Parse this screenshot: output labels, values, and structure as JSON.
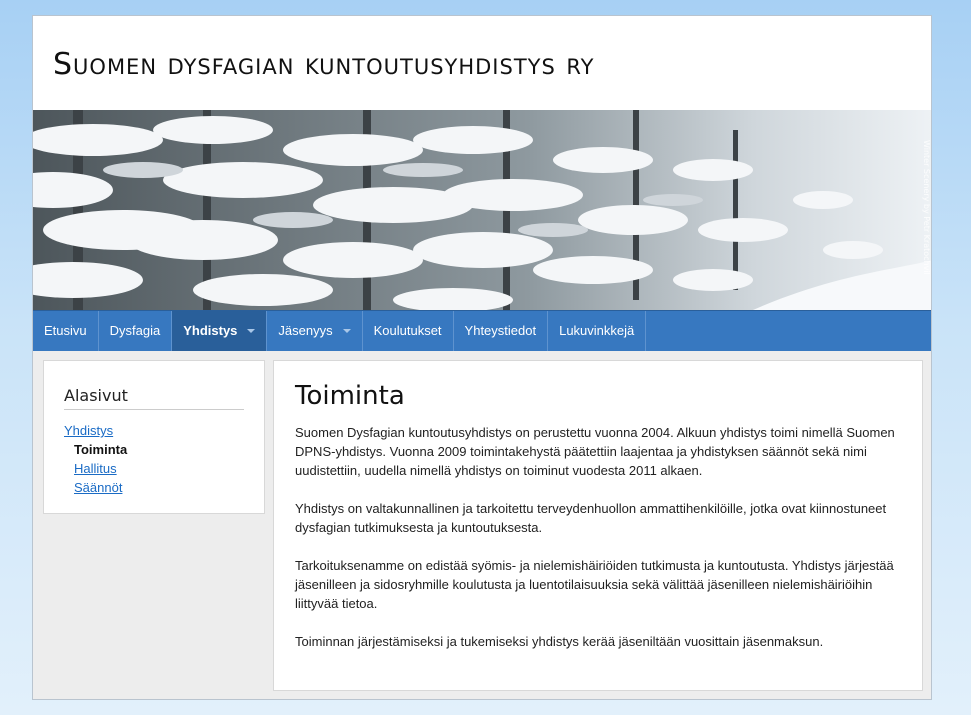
{
  "header": {
    "site_title": "Suomen dysfagian kuntoutusyhdistys ry"
  },
  "banner": {
    "credit": "Winter Scenery by Petr Kratochvil"
  },
  "nav": {
    "items": [
      {
        "label": "Etusivu"
      },
      {
        "label": "Dysfagia"
      },
      {
        "label": "Yhdistys",
        "active": true
      },
      {
        "label": "Jäsenyys"
      },
      {
        "label": "Koulutukset"
      },
      {
        "label": "Yhteystiedot"
      },
      {
        "label": "Lukuvinkkejä"
      }
    ]
  },
  "sidebar": {
    "title": "Alasivut",
    "parent_link": "Yhdistys",
    "current": "Toiminta",
    "links": [
      "Hallitus",
      "Säännöt"
    ]
  },
  "content": {
    "title": "Toiminta",
    "paragraphs": [
      "Suomen Dysfagian kuntoutusyhdistys on perustettu vuonna 2004.  Alkuun yhdistys toimi nimellä Suomen DPNS-yhdistys. Vuonna 2009 toimintakehystä päätettiin laajentaa ja yhdistyksen säännöt sekä nimi uudistettiin, uudella nimellä yhdistys on toiminut vuodesta 2011 alkaen.",
      "Yhdistys on valtakunnallinen ja tarkoitettu terveydenhuollon ammattihenkilöille, jotka ovat kiinnostuneet dysfagian tutkimuksesta ja kuntoutuksesta.",
      "Tarkoituksenamme on edistää syömis- ja nielemishäiriöiden tutkimusta ja kuntoutusta. Yhdistys järjestää jäsenilleen ja sidosryhmille koulutusta ja luentotilaisuuksia sekä välittää jäsenilleen nielemishäiriöihin liittyvää tietoa.",
      "Toiminnan järjestämiseksi ja tukemiseksi yhdistys kerää jäseniltään vuosittain jäsenmaksun."
    ]
  },
  "colors": {
    "nav": "#3778c0",
    "nav_active": "#295f9a",
    "link": "#1a6bc5"
  }
}
